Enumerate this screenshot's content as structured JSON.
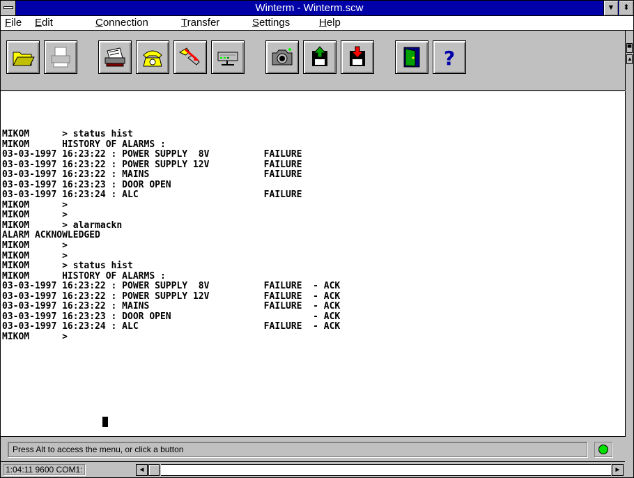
{
  "window": {
    "title": "Winterm - Winterm.scw",
    "min_glyph": "▼",
    "max_glyph": "⬍"
  },
  "menu": {
    "items": [
      {
        "label_u": "F",
        "label_rest": "ile"
      },
      {
        "label_u": "E",
        "label_rest": "dit"
      },
      {
        "label_u": "C",
        "label_rest": "onnection"
      },
      {
        "label_u": "T",
        "label_rest": "ransfer"
      },
      {
        "label_u": "S",
        "label_rest": "ettings"
      },
      {
        "label_u": "H",
        "label_rest": "elp"
      }
    ]
  },
  "toolbar": {
    "buttons": [
      "open-folder-icon",
      "print-icon",
      "printer-setup-icon",
      "phone-dial-icon",
      "hangup-icon",
      "modem-icon",
      "camera-icon",
      "upload-icon",
      "download-icon",
      "exit-door-icon",
      "help-icon"
    ],
    "help_glyph": "?"
  },
  "terminal": {
    "lines": [
      "MIKOM      > status hist",
      "MIKOM      HISTORY OF ALARMS :",
      "03-03-1997 16:23:22 : POWER SUPPLY  8V          FAILURE",
      "03-03-1997 16:23:22 : POWER SUPPLY 12V          FAILURE",
      "03-03-1997 16:23:22 : MAINS                     FAILURE",
      "03-03-1997 16:23:23 : DOOR OPEN",
      "03-03-1997 16:23:24 : ALC                       FAILURE",
      "MIKOM      >",
      "MIKOM      >",
      "MIKOM      > alarmackn",
      "ALARM ACKNOWLEDGED",
      "MIKOM      >",
      "MIKOM      >",
      "MIKOM      > status hist",
      "MIKOM      HISTORY OF ALARMS :",
      "03-03-1997 16:23:22 : POWER SUPPLY  8V          FAILURE  - ACK",
      "03-03-1997 16:23:22 : POWER SUPPLY 12V          FAILURE  - ACK",
      "03-03-1997 16:23:22 : MAINS                     FAILURE  - ACK",
      "03-03-1997 16:23:23 : DOOR OPEN                          - ACK",
      "03-03-1997 16:23:24 : ALC                       FAILURE  - ACK",
      "MIKOM      >"
    ]
  },
  "status": {
    "text": "Press Alt to access the menu, or click a button",
    "led_color": "#00e000"
  },
  "info": {
    "text": "1:04:11  9600  COM1:",
    "left_arrow": "◄",
    "right_arrow": "►"
  },
  "colors": {
    "titlebar": "#0000a8",
    "chrome": "#c0c0c0"
  }
}
